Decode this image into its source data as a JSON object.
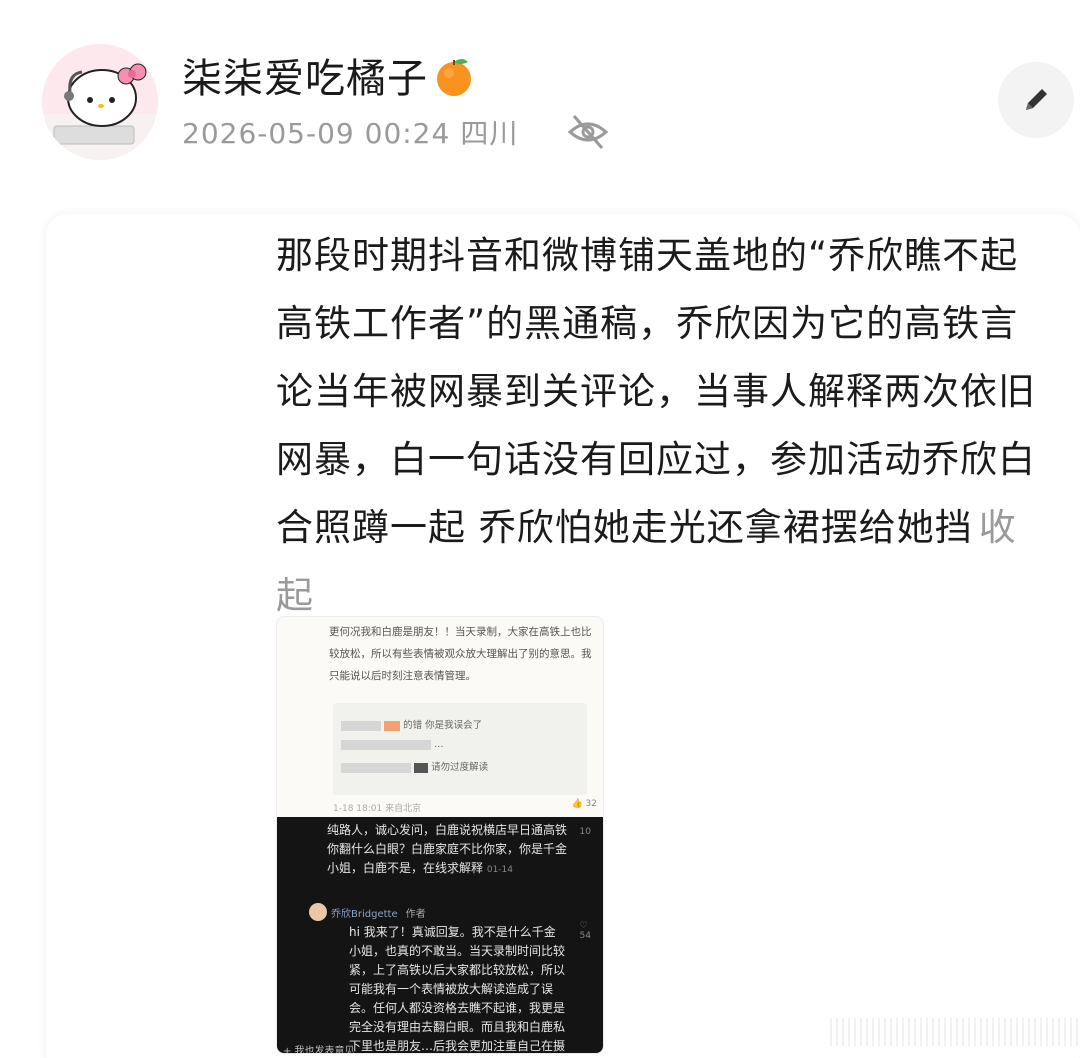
{
  "header": {
    "username": "柒柒爱吃橘子",
    "timestamp": "2026-05-09 00:24",
    "location": "四川"
  },
  "post": {
    "text": "那段时期抖音和微博铺天盖地的“乔欣瞧不起高铁工作者”的黑通稿，乔欣因为它的高铁言论当年被网暴到关评论，当事人解释两次依旧网暴，白一句话没有回应过，参加活动乔欣白合照蹲一起  乔欣怕她走光还拿裙摆给她挡",
    "collapse_label": "收起"
  },
  "screenshot": {
    "note_text": "更何况我和白鹿是朋友！！当天录制，大家在高铁上也比较放松，所以有些表情被观众放大理解出了别的意思。我只能说以后时刻注意表情管理。",
    "note_box_lines": [
      "的错 你是我误会了",
      "…",
      "请勿过度解读"
    ],
    "note_time": "1-18 18:01  来自北京",
    "note_likes": "32",
    "comment1_text": "纯路人，诚心发问，白鹿说祝横店早日通高铁你翻什么白眼？白鹿家庭不比你家，你是千金小姐，白鹿不是，在线求解释",
    "comment1_date": "01-14",
    "comment1_likes": "10",
    "reply_name": "乔欣Bridgette",
    "reply_tag": "作者",
    "reply_text": "hi 我来了！真诚回复。我不是什么千金小姐，也真的不敢当。当天录制时间比较紧，上了高铁以后大家都比较放松，所以可能我有一个表情被放大解读造成了误会。任何人都没资格去瞧不起谁，我更是完全没有理由去翻白眼。而且我和白鹿私下里也是朋友…后我会更加注重自己在摄影机",
    "reply_likes": "54",
    "footer": "+ 我也发表意见"
  },
  "icons": {
    "edit": "pencil-icon",
    "privacy": "eye-off-icon",
    "emoji": "orange-emoji"
  }
}
